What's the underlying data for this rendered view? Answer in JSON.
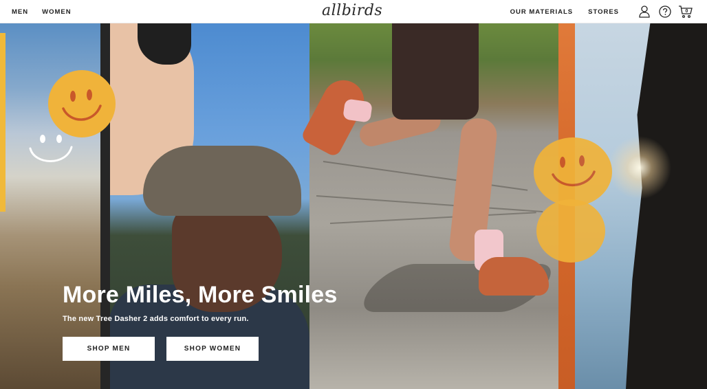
{
  "header": {
    "nav_left": [
      {
        "label": "MEN"
      },
      {
        "label": "WOMEN"
      }
    ],
    "logo_text": "allbirds",
    "nav_right": [
      {
        "label": "OUR MATERIALS"
      },
      {
        "label": "STORES"
      }
    ],
    "cart_count": "0",
    "icons": [
      "account-icon",
      "help-icon",
      "cart-icon"
    ]
  },
  "hero": {
    "title": "More Miles, More Smiles",
    "subtitle": "The new Tree Dasher 2 adds comfort to every run.",
    "buttons": {
      "shop_men": "SHOP MEN",
      "shop_women": "SHOP WOMEN"
    },
    "colors": {
      "smiley_yellow": "#f0b33a",
      "stripe_orange": "#e07a3a",
      "cta_background": "#ffffff"
    }
  }
}
